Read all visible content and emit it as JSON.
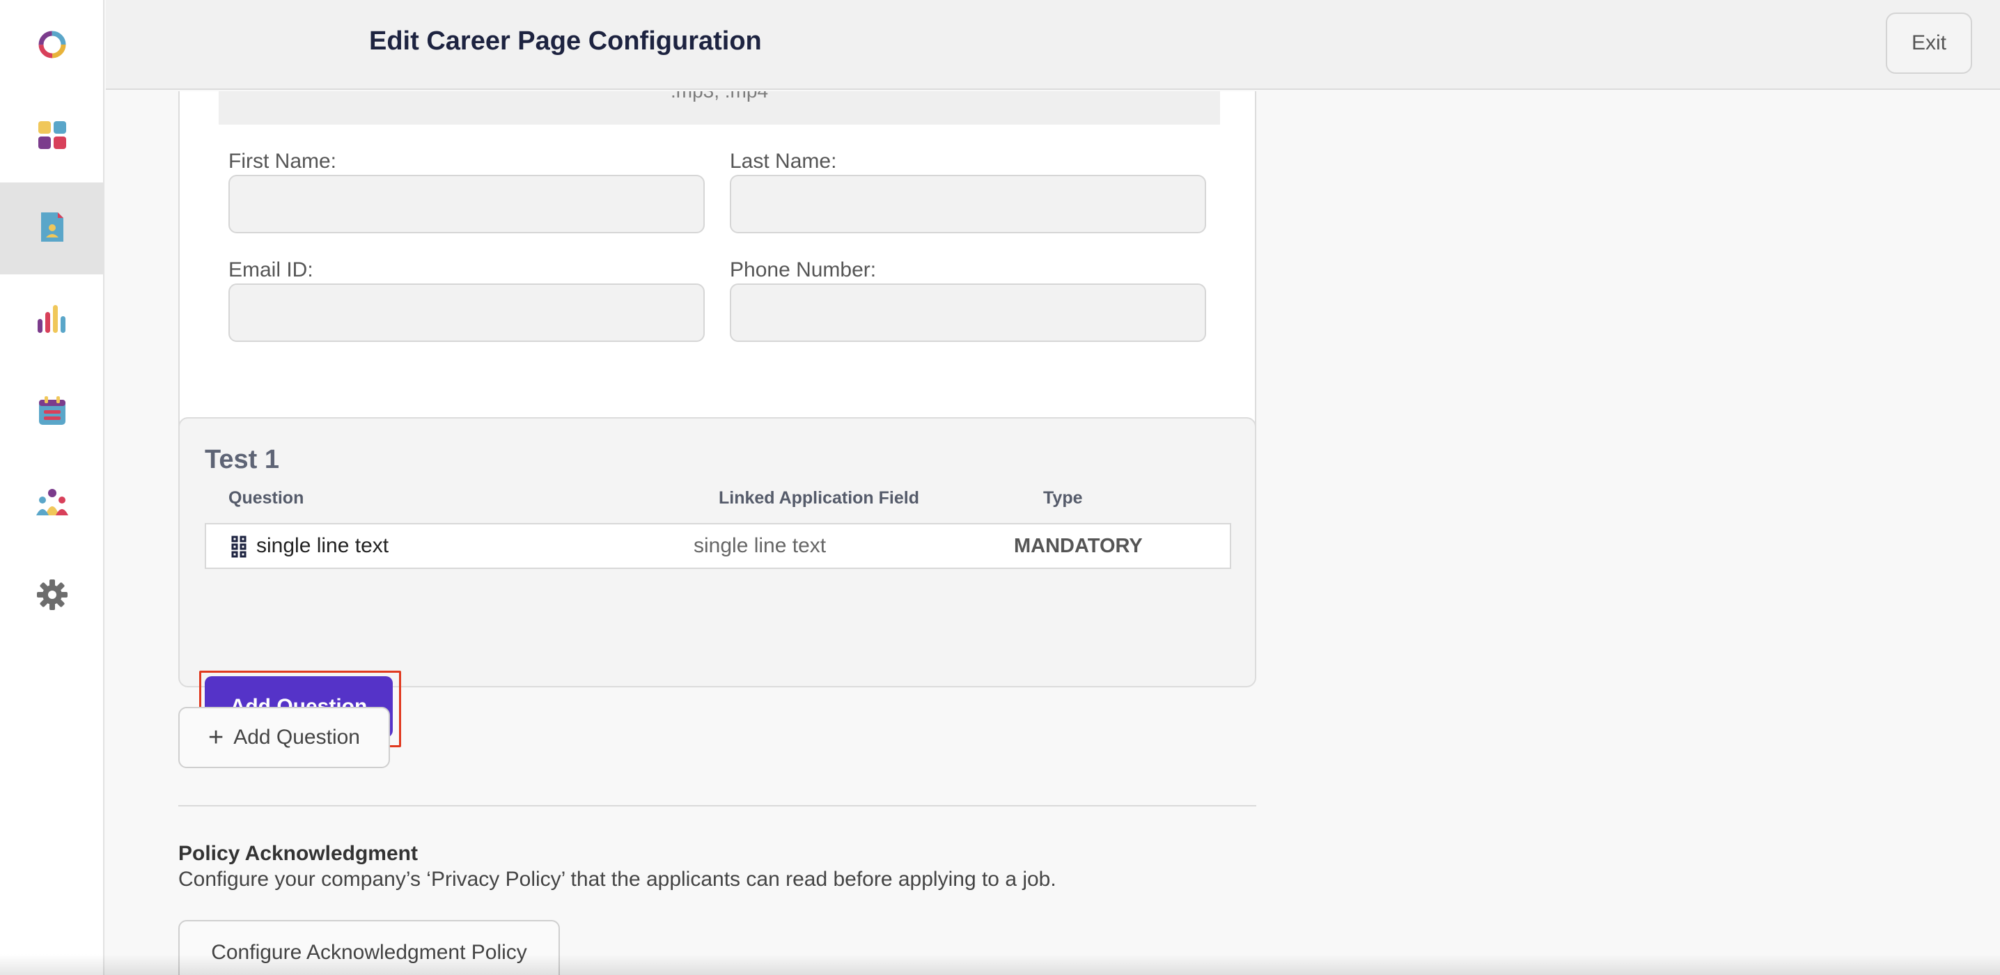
{
  "header": {
    "title": "Edit Career Page Configuration",
    "exit_label": "Exit"
  },
  "sidebar": {
    "items": [
      {
        "icon": "logo-icon"
      },
      {
        "icon": "dashboard-icon"
      },
      {
        "icon": "document-user-icon",
        "active": true
      },
      {
        "icon": "bar-chart-icon"
      },
      {
        "icon": "calendar-icon"
      },
      {
        "icon": "team-icon"
      },
      {
        "icon": "gear-icon"
      }
    ]
  },
  "form": {
    "upload_hint": ".mp3, .mp4",
    "first_name_label": "First Name:",
    "last_name_label": "Last Name:",
    "email_label": "Email ID:",
    "phone_label": "Phone Number:"
  },
  "section": {
    "title": "Test 1",
    "columns": {
      "question": "Question",
      "linked": "Linked Application Field",
      "type": "Type"
    },
    "rows": [
      {
        "question": "single line text",
        "linked": "single line text",
        "type": "MANDATORY"
      }
    ],
    "add_label": "Add Question"
  },
  "outer_add_label": "Add Question",
  "policy": {
    "title": "Policy Acknowledgment",
    "description": "Configure your company’s ‘Privacy Policy’ that the applicants can read before applying to a job.",
    "button_label": "Configure Acknowledgment Policy"
  },
  "colors": {
    "accent": "#5533c8",
    "highlight": "#e0391f"
  }
}
